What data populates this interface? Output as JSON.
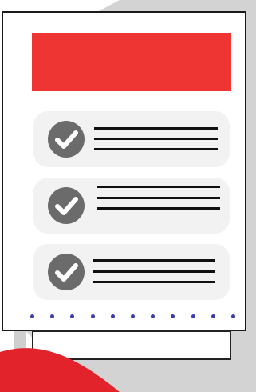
{
  "colors": {
    "header": "#ef3434",
    "card_border": "#1a1a1a",
    "item_bg": "#f2f2f2",
    "check_circle": "#6b6b6b",
    "lines": "#111111",
    "dots": "#3b3bb0",
    "shadow": "#d2d2d2",
    "accent_red": "#e2232b"
  },
  "icons": {
    "check": "check-circle-icon"
  },
  "items": [
    {
      "checked": true
    },
    {
      "checked": true
    },
    {
      "checked": true
    }
  ],
  "dots_count": 11
}
